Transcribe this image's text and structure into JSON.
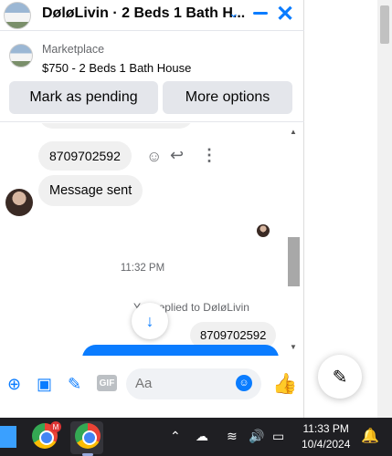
{
  "chat": {
    "title": "DøløLivin · 2 Beds 1 Bath H...",
    "listing": {
      "category": "Marketplace",
      "summary": "$750 - 2 Beds 1 Bath House",
      "mark_pending_label": "Mark as pending",
      "more_options_label": "More options"
    },
    "messages": {
      "phone_message": "8709702592",
      "sent_message": "Message sent",
      "timestamp": "11:32 PM",
      "replied_to_text": "You replied to DøløLivin",
      "replied_quote": "8709702592"
    },
    "composer": {
      "placeholder": "Aa"
    }
  },
  "taskbar": {
    "time": "11:33 PM",
    "date": "10/4/2024",
    "chrome_badge": "M"
  },
  "colors": {
    "accent": "#0a7cff",
    "bubble_gray": "#f0f0f0"
  }
}
